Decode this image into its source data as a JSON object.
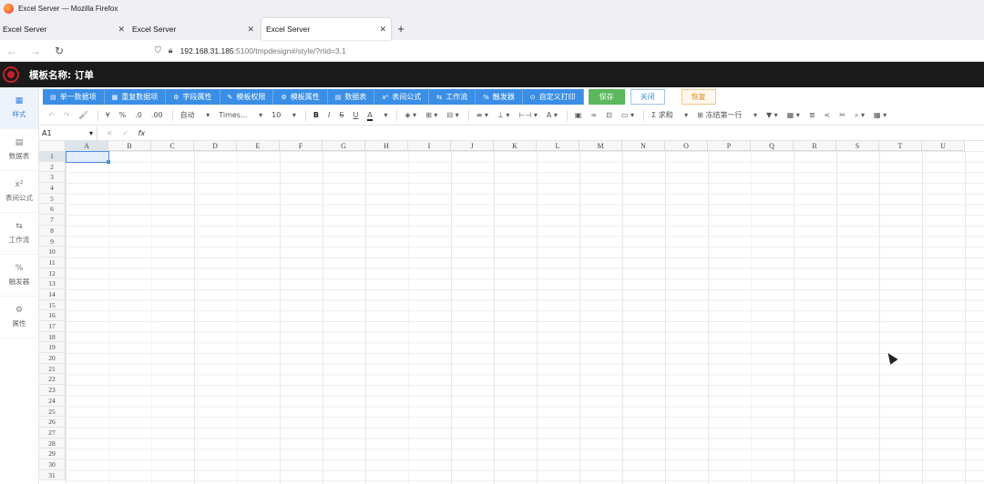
{
  "window": {
    "title": "Excel Server — Mozilla Firefox"
  },
  "tabs": [
    {
      "label": "Excel Server"
    },
    {
      "label": "Excel Server"
    },
    {
      "label": "Excel Server"
    }
  ],
  "address": {
    "host": "192.168.31.185",
    "rest": ":5100/tmpdesign#/style/?rtid=3.1"
  },
  "app": {
    "template_title": "模板名称: 订单"
  },
  "leftnav": [
    {
      "label": "样式",
      "icon": "table-icon"
    },
    {
      "label": "数据表",
      "icon": "database-icon"
    },
    {
      "label": "表间公式",
      "icon": "formula-icon"
    },
    {
      "label": "工作流",
      "icon": "workflow-icon"
    },
    {
      "label": "触发器",
      "icon": "link-icon"
    },
    {
      "label": "属性",
      "icon": "gear-icon"
    }
  ],
  "actions": [
    {
      "label": "单一数据项",
      "icon": "list-icon"
    },
    {
      "label": "重复数据项",
      "icon": "grid-icon"
    },
    {
      "label": "字段属性",
      "icon": "gear-icon"
    },
    {
      "label": "模板权限",
      "icon": "edit-icon"
    },
    {
      "label": "模板属性",
      "icon": "gear-icon"
    },
    {
      "label": "数据表",
      "icon": "database-icon"
    },
    {
      "label": "表间公式",
      "icon": "formula-icon"
    },
    {
      "label": "工作流",
      "icon": "workflow-icon"
    },
    {
      "label": "触发器",
      "icon": "link-icon"
    },
    {
      "label": "自定义打印",
      "icon": "print-icon"
    }
  ],
  "buttons": {
    "save": "保存",
    "close": "关闭",
    "restore": "恢复"
  },
  "format": {
    "currency": "¥",
    "percent": "%",
    "dec_add": ".0",
    "dec_remove": ".00",
    "number_format": "自动",
    "font": "Times...",
    "size": "10",
    "bold": "B",
    "italic": "I",
    "strike": "S",
    "underline": "U",
    "font_color": "A",
    "sum": "Σ 求和",
    "freeze": "冻结第一行"
  },
  "formula": {
    "cell_ref": "A1",
    "fx": "fx"
  },
  "columns": [
    "A",
    "B",
    "C",
    "D",
    "E",
    "F",
    "G",
    "H",
    "I",
    "J",
    "K",
    "L",
    "M",
    "N",
    "O",
    "P",
    "Q",
    "R",
    "S",
    "T",
    "U"
  ],
  "rows": [
    "1",
    "2",
    "3",
    "4",
    "5",
    "6",
    "7",
    "8",
    "9",
    "10",
    "11",
    "12",
    "13",
    "14",
    "15",
    "16",
    "17",
    "18",
    "19",
    "20",
    "21",
    "22",
    "23",
    "24",
    "25",
    "26",
    "27",
    "28",
    "29",
    "30",
    "31"
  ]
}
